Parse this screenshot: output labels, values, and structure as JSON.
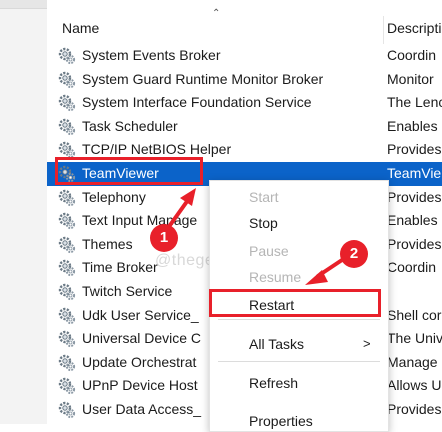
{
  "header": {
    "name": "Name",
    "description": "Descripti"
  },
  "services": [
    {
      "name": "System Events Broker",
      "description": "Coordin"
    },
    {
      "name": "System Guard Runtime Monitor Broker",
      "description": "Monitor"
    },
    {
      "name": "System Interface Foundation Service",
      "description": "The Lenc"
    },
    {
      "name": "Task Scheduler",
      "description": "Enables"
    },
    {
      "name": "TCP/IP NetBIOS Helper",
      "description": "Provides"
    },
    {
      "name": "TeamViewer",
      "description": "TeamVie"
    },
    {
      "name": "Telephony",
      "description": "Provides"
    },
    {
      "name": "Text Input Manage",
      "description": "Enables"
    },
    {
      "name": "Themes",
      "description": "Provides"
    },
    {
      "name": "Time Broker",
      "description": "Coordin"
    },
    {
      "name": "Twitch Service",
      "description": ""
    },
    {
      "name": "Udk User Service_",
      "description": "Shell cor"
    },
    {
      "name": "Universal Device C",
      "description": "The Univ"
    },
    {
      "name": "Update Orchestrat",
      "description": "Manage"
    },
    {
      "name": "UPnP Device Host",
      "description": "Allows U"
    },
    {
      "name": "User Data Access_",
      "description": "Provides"
    }
  ],
  "selected_index": 5,
  "context_menu": {
    "start": "Start",
    "stop": "Stop",
    "pause": "Pause",
    "resume": "Resume",
    "restart": "Restart",
    "all_tasks": "All Tasks",
    "all_tasks_chevron": ">",
    "refresh": "Refresh",
    "properties": "Properties"
  },
  "annotations": {
    "step1": "1",
    "step2": "2",
    "color": "#e8202a"
  },
  "watermark": "@thegeekpage.com",
  "colors": {
    "selection": "#0b63c9",
    "highlight": "#e8202a"
  },
  "icons": {
    "service": "gear-icon",
    "sort": "sort-ascending-icon"
  }
}
